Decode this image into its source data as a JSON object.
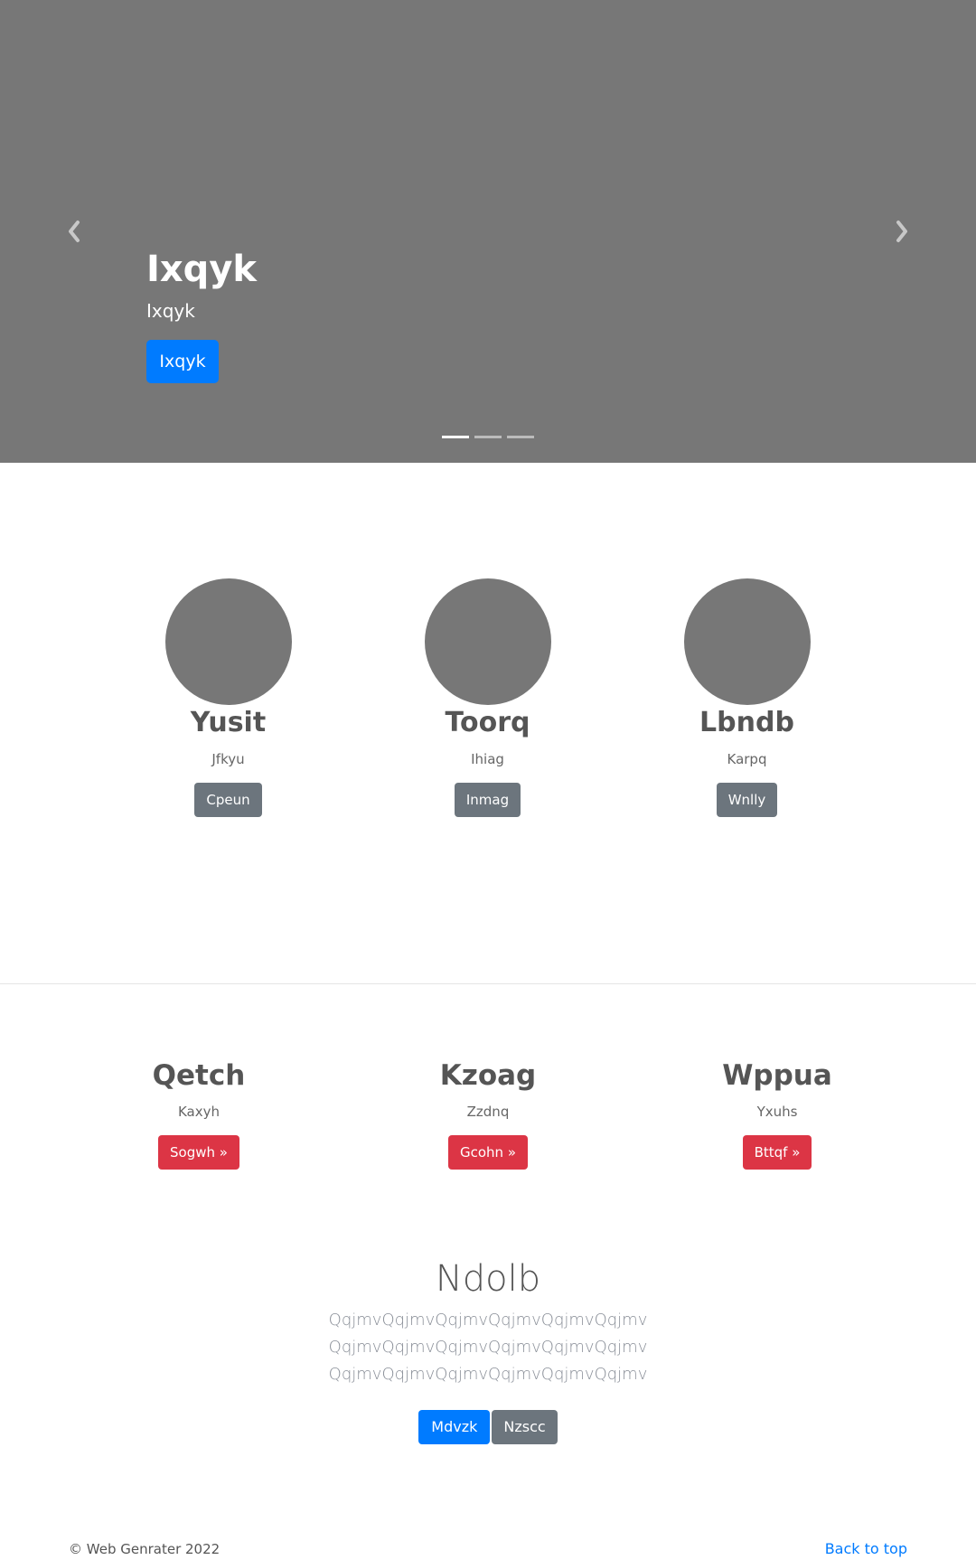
{
  "hero": {
    "title": "Ixqyk",
    "subtitle": "Ixqyk",
    "button_label": "Ixqyk",
    "prev_icon": "chevron-left-icon",
    "next_icon": "chevron-right-icon",
    "indicator_count": 3,
    "active_indicator": 1,
    "background": "#777777",
    "button_color": "#007bff"
  },
  "features": [
    {
      "name": "Yusit",
      "subtitle": "Jfkyu",
      "button_label": "Cpeun"
    },
    {
      "name": "Toorq",
      "subtitle": "Ihiag",
      "button_label": "Inmag"
    },
    {
      "name": "Lbndb",
      "subtitle": "Karpq",
      "button_label": "Wnlly"
    }
  ],
  "columns": [
    {
      "title": "Qetch",
      "subtitle": "Kaxyh",
      "button_label": "Sogwh »"
    },
    {
      "title": "Kzoag",
      "subtitle": "Zzdnq",
      "button_label": "Gcohn »"
    },
    {
      "title": "Wppua",
      "subtitle": "Yxuhs",
      "button_label": "Bttqf »"
    }
  ],
  "cta": {
    "title": "Ndolb",
    "body": "QqjmvQqjmvQqjmvQqjmvQqjmvQqjmvQqjmvQqjmvQqjmvQqjmvQqjmvQqjmvQqjmvQqjmvQqjmvQqjmvQqjmvQqjmv",
    "primary_label": "Mdvzk",
    "secondary_label": "Nzscc"
  },
  "footer": {
    "copyright": "© Web Genrater 2022",
    "back_to_top": "Back to top"
  },
  "colors": {
    "primary": "#007bff",
    "secondary": "#6c757d",
    "danger": "#dc3545",
    "placeholder": "#777777"
  }
}
